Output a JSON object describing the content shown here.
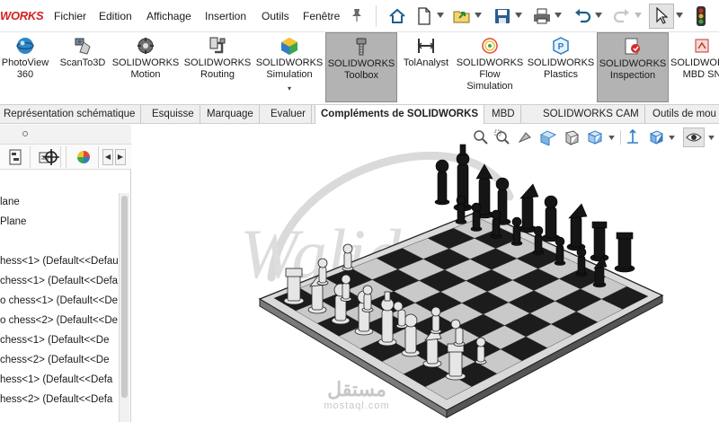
{
  "app": {
    "logo_text": "WORKS"
  },
  "menu": [
    "Fichier",
    "Edition",
    "Affichage",
    "Insertion",
    "Outils",
    "Fenêtre"
  ],
  "quick_access": [
    "home-icon",
    "new-document-icon",
    "open-icon",
    "save-icon",
    "print-icon",
    "undo-icon",
    "redo-icon",
    "select-cursor-icon",
    "traffic-light-icon"
  ],
  "ribbon": [
    {
      "label": "PhotoView\n360",
      "icon": "photoview-icon"
    },
    {
      "label": "ScanTo3D",
      "icon": "scanto3d-icon"
    },
    {
      "label": "SOLIDWORKS\nMotion",
      "icon": "motion-icon"
    },
    {
      "label": "SOLIDWORKS\nRouting",
      "icon": "routing-icon"
    },
    {
      "label": "SOLIDWORKS\nSimulation",
      "icon": "simulation-icon",
      "dropdown": "▾"
    },
    {
      "label": "SOLIDWORKS\nToolbox",
      "icon": "toolbox-icon",
      "active": true
    },
    {
      "label": "TolAnalyst",
      "icon": "tolanalyst-icon"
    },
    {
      "label": "SOLIDWORKS\nFlow\nSimulation",
      "icon": "flow-simulation-icon"
    },
    {
      "label": "SOLIDWORKS\nPlastics",
      "icon": "plastics-icon"
    },
    {
      "label": "SOLIDWORKS\nInspection",
      "icon": "inspection-icon",
      "active": true
    },
    {
      "label": "SOLIDWORKS\nMBD SN",
      "icon": "mbd-icon"
    }
  ],
  "tabs": [
    "Représentation schématique",
    "Esquisse",
    "Marquage",
    "Evaluer",
    "Compléments de SOLIDWORKS",
    "MBD",
    "SOLIDWORKS CAM",
    "Outils de mou"
  ],
  "active_tab": "Compléments de SOLIDWORKS",
  "feature_tree": [
    "lane",
    "Plane",
    "",
    "hess<1> (Default<<Defaul",
    "chess<1> (Default<<Defa",
    "o chess<1> (Default<<De",
    "o chess<2> (Default<<De",
    "chess<1> (Default<<De",
    "chess<2> (Default<<De",
    "hess<1> (Default<<Defa",
    "hess<2> (Default<<Defa"
  ],
  "watermark": {
    "script": "Walid",
    "arabic": "مستقل",
    "latin": "mostaql.com"
  },
  "colors": {
    "accent": "#d6201f",
    "ribbon_active": "#b3b3b3",
    "board_light": "#c9c9c9",
    "board_dark": "#1c1c1c"
  }
}
